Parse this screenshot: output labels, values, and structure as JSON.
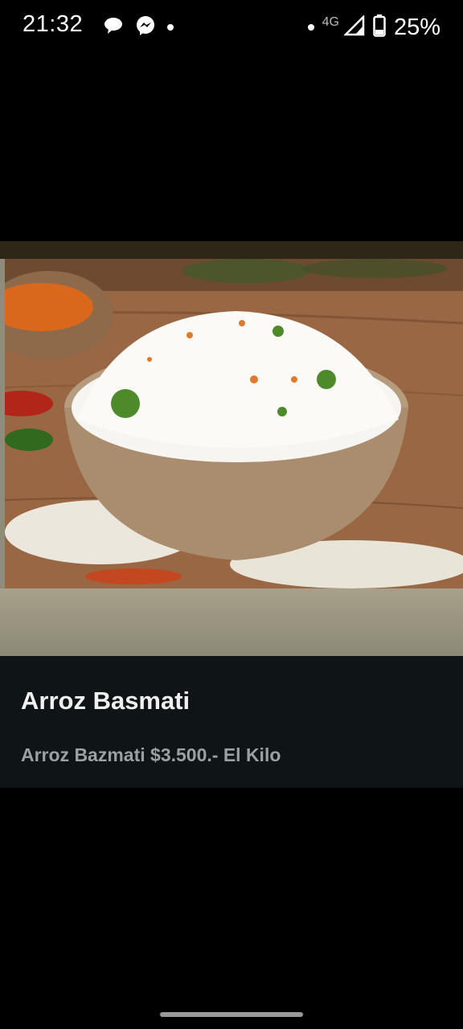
{
  "status_bar": {
    "time": "21:32",
    "network_type": "4G",
    "battery": "25%",
    "icons": [
      "chat-bubble-icon",
      "messenger-icon",
      "notification-dot-icon",
      "signal-icon",
      "battery-icon"
    ]
  },
  "product": {
    "image_alt": "bowl-of-rice-photo",
    "title": "Arroz Basmati",
    "description": "Arroz Bazmati $3.500.- El Kilo"
  },
  "colors": {
    "background": "#000000",
    "card": "#0f1417",
    "title_text": "#f0f0f0",
    "desc_text": "#9aa0a3"
  }
}
